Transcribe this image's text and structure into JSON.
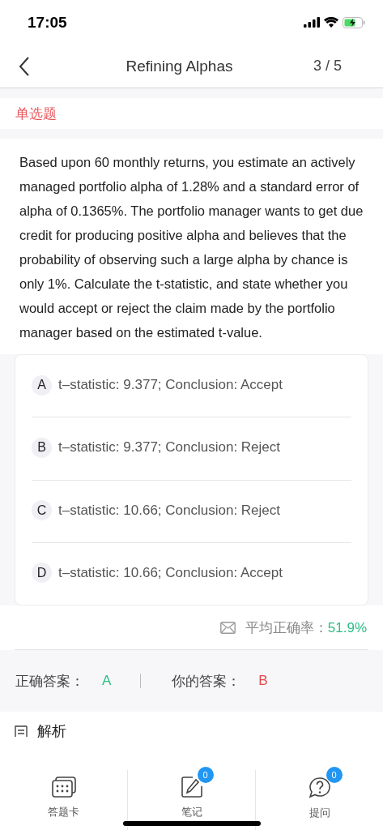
{
  "status_bar": {
    "time": "17:05"
  },
  "nav": {
    "title": "Refining Alphas",
    "progress": "3 / 5"
  },
  "question": {
    "type": "单选题",
    "text": "Based upon 60 monthly returns, you estimate an actively managed portfolio alpha of 1.28% and a standard error of alpha of 0.1365%. The portfolio manager wants to get due credit for producing positive alpha and believes that the probability of observing such a large alpha by chance is only 1%. Calculate the t-statistic, and state whether you would accept or reject the claim made by the portfolio manager based on the estimated t-value.",
    "options": [
      {
        "letter": "A",
        "text": "t–statistic: 9.377; Conclusion: Accept"
      },
      {
        "letter": "B",
        "text": "t–statistic: 9.377; Conclusion: Reject"
      },
      {
        "letter": "C",
        "text": "t–statistic: 10.66; Conclusion: Reject"
      },
      {
        "letter": "D",
        "text": "t–statistic: 10.66; Conclusion: Accept"
      }
    ]
  },
  "stats": {
    "label": "平均正确率：",
    "value": "51.9%"
  },
  "answers": {
    "correct_label": "正确答案：",
    "correct": "A",
    "yours_label": "你的答案：",
    "yours": "B"
  },
  "analysis": {
    "title": "解析"
  },
  "tab_bar": [
    {
      "kind": "card",
      "label": "答题卡"
    },
    {
      "kind": "note",
      "label": "笔记",
      "badge": "0"
    },
    {
      "kind": "question",
      "label": "提问",
      "badge": "0"
    }
  ]
}
